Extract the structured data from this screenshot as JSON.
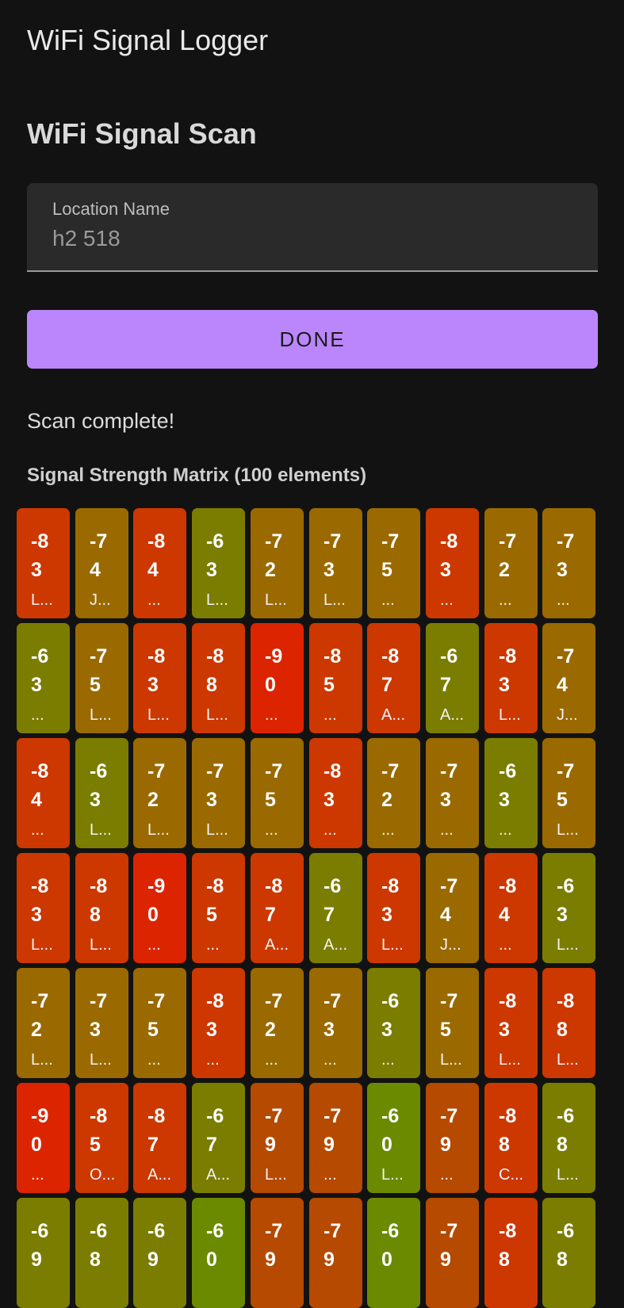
{
  "app_title": "WiFi Signal Logger",
  "section_title": "WiFi Signal Scan",
  "location_field": {
    "label": "Location Name",
    "value": "h2 518"
  },
  "done_button_label": "DONE",
  "status_text": "Scan complete!",
  "matrix_title": "Signal Strength Matrix (100 elements)",
  "colors": {
    "background": "#121212",
    "accent": "#bb86fc",
    "strong": "#6b8a00",
    "good": "#7b7d00",
    "fair": "#9a6a00",
    "weak": "#b54a00",
    "poor": "#cc3800",
    "very_poor": "#dd2400"
  },
  "matrix": [
    [
      {
        "v": "-83",
        "l": "L..."
      },
      {
        "v": "-74",
        "l": "J..."
      },
      {
        "v": "-84",
        "l": "..."
      },
      {
        "v": "-63",
        "l": "L..."
      },
      {
        "v": "-72",
        "l": "L..."
      },
      {
        "v": "-73",
        "l": "L..."
      },
      {
        "v": "-75",
        "l": "..."
      },
      {
        "v": "-83",
        "l": "..."
      },
      {
        "v": "-72",
        "l": "..."
      },
      {
        "v": "-73",
        "l": "..."
      }
    ],
    [
      {
        "v": "-63",
        "l": "..."
      },
      {
        "v": "-75",
        "l": "L..."
      },
      {
        "v": "-83",
        "l": "L..."
      },
      {
        "v": "-88",
        "l": "L..."
      },
      {
        "v": "-90",
        "l": "..."
      },
      {
        "v": "-85",
        "l": "..."
      },
      {
        "v": "-87",
        "l": "A..."
      },
      {
        "v": "-67",
        "l": "A..."
      },
      {
        "v": "-83",
        "l": "L..."
      },
      {
        "v": "-74",
        "l": "J..."
      }
    ],
    [
      {
        "v": "-84",
        "l": "..."
      },
      {
        "v": "-63",
        "l": "L..."
      },
      {
        "v": "-72",
        "l": "L..."
      },
      {
        "v": "-73",
        "l": "L..."
      },
      {
        "v": "-75",
        "l": "..."
      },
      {
        "v": "-83",
        "l": "..."
      },
      {
        "v": "-72",
        "l": "..."
      },
      {
        "v": "-73",
        "l": "..."
      },
      {
        "v": "-63",
        "l": "..."
      },
      {
        "v": "-75",
        "l": "L..."
      }
    ],
    [
      {
        "v": "-83",
        "l": "L..."
      },
      {
        "v": "-88",
        "l": "L..."
      },
      {
        "v": "-90",
        "l": "..."
      },
      {
        "v": "-85",
        "l": "..."
      },
      {
        "v": "-87",
        "l": "A..."
      },
      {
        "v": "-67",
        "l": "A..."
      },
      {
        "v": "-83",
        "l": "L..."
      },
      {
        "v": "-74",
        "l": "J..."
      },
      {
        "v": "-84",
        "l": "..."
      },
      {
        "v": "-63",
        "l": "L..."
      }
    ],
    [
      {
        "v": "-72",
        "l": "L..."
      },
      {
        "v": "-73",
        "l": "L..."
      },
      {
        "v": "-75",
        "l": "..."
      },
      {
        "v": "-83",
        "l": "..."
      },
      {
        "v": "-72",
        "l": "..."
      },
      {
        "v": "-73",
        "l": "..."
      },
      {
        "v": "-63",
        "l": "..."
      },
      {
        "v": "-75",
        "l": "L..."
      },
      {
        "v": "-83",
        "l": "L..."
      },
      {
        "v": "-88",
        "l": "L..."
      }
    ],
    [
      {
        "v": "-90",
        "l": "..."
      },
      {
        "v": "-85",
        "l": "O..."
      },
      {
        "v": "-87",
        "l": "A..."
      },
      {
        "v": "-67",
        "l": "A..."
      },
      {
        "v": "-79",
        "l": "L..."
      },
      {
        "v": "-79",
        "l": "..."
      },
      {
        "v": "-60",
        "l": "L..."
      },
      {
        "v": "-79",
        "l": "..."
      },
      {
        "v": "-88",
        "l": "C..."
      },
      {
        "v": "-68",
        "l": "L..."
      }
    ],
    [
      {
        "v": "-69",
        "l": ""
      },
      {
        "v": "-68",
        "l": ""
      },
      {
        "v": "-69",
        "l": ""
      },
      {
        "v": "-60",
        "l": ""
      },
      {
        "v": "-79",
        "l": ""
      },
      {
        "v": "-79",
        "l": ""
      },
      {
        "v": "-60",
        "l": ""
      },
      {
        "v": "-79",
        "l": ""
      },
      {
        "v": "-88",
        "l": ""
      },
      {
        "v": "-68",
        "l": ""
      }
    ]
  ]
}
